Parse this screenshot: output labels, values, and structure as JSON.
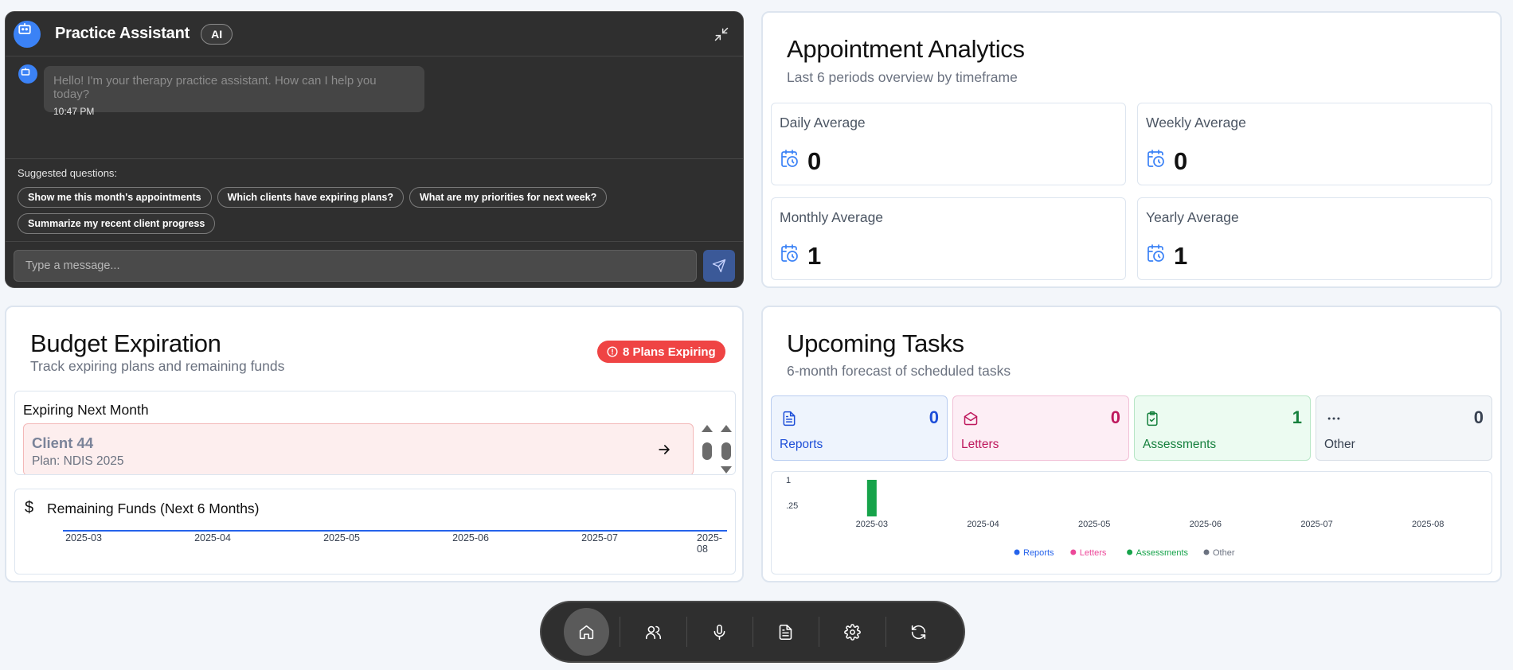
{
  "chat": {
    "title": "Practice Assistant",
    "badge": "AI",
    "message": {
      "text": "Hello! I'm your therapy practice assistant. How can I help you today?",
      "time": "10:47 PM"
    },
    "suggested_label": "Suggested questions:",
    "suggestions": [
      "Show me this month's appointments",
      "Which clients have expiring plans?",
      "What are my priorities for next week?",
      "Summarize my recent client progress"
    ],
    "input_placeholder": "Type a message..."
  },
  "analytics": {
    "title": "Appointment Analytics",
    "subtitle": "Last 6 periods overview by timeframe",
    "stats": [
      {
        "label": "Daily Average",
        "value": "0"
      },
      {
        "label": "Weekly Average",
        "value": "0"
      },
      {
        "label": "Monthly Average",
        "value": "1"
      },
      {
        "label": "Yearly Average",
        "value": "1"
      }
    ]
  },
  "budget": {
    "title": "Budget Expiration",
    "subtitle": "Track expiring plans and remaining funds",
    "badge": "8 Plans Expiring",
    "expiring_heading": "Expiring Next Month",
    "client": {
      "name": "Client 44",
      "plan": "Plan: NDIS 2025"
    },
    "funds_heading": "Remaining Funds (Next 6 Months)",
    "funds_months": [
      "2025-03",
      "2025-04",
      "2025-05",
      "2025-06",
      "2025-07",
      "2025-08"
    ]
  },
  "tasks": {
    "title": "Upcoming Tasks",
    "subtitle": "6-month forecast of scheduled tasks",
    "categories": [
      {
        "label": "Reports",
        "count": "0",
        "color": "#1d4ed8",
        "bg": "#eef4fd",
        "border": "#b9cdf0",
        "icon": "document-icon"
      },
      {
        "label": "Letters",
        "count": "0",
        "color": "#be185d",
        "bg": "#fdeef5",
        "border": "#f1bfd6",
        "icon": "envelope-open-icon"
      },
      {
        "label": "Assessments",
        "count": "1",
        "color": "#15803d",
        "bg": "#ecfbf1",
        "border": "#b7e6c6",
        "icon": "clipboard-check-icon"
      },
      {
        "label": "Other",
        "count": "0",
        "color": "#374151",
        "bg": "#f3f6f9",
        "border": "#d8dee6",
        "icon": "ellipsis-icon"
      }
    ]
  },
  "chart_data": {
    "type": "bar",
    "categories": [
      "2025-03",
      "2025-04",
      "2025-05",
      "2025-06",
      "2025-07",
      "2025-08"
    ],
    "series": [
      {
        "name": "Reports",
        "values": [
          0,
          0,
          0,
          0,
          0,
          0
        ],
        "color": "#2563eb"
      },
      {
        "name": "Letters",
        "values": [
          0,
          0,
          0,
          0,
          0,
          0
        ],
        "color": "#ec4899"
      },
      {
        "name": "Assessments",
        "values": [
          1,
          0,
          0,
          0,
          0,
          0
        ],
        "color": "#16a34a"
      },
      {
        "name": "Other",
        "values": [
          0,
          0,
          0,
          0,
          0,
          0
        ],
        "color": "#6b7280"
      }
    ],
    "y_tick_labels": [
      "1",
      ".25"
    ],
    "ylim": [
      0,
      1
    ],
    "legend": "bottom-center"
  },
  "nav": {
    "items": [
      {
        "name": "home-icon",
        "active": true
      },
      {
        "name": "users-icon",
        "active": false
      },
      {
        "name": "microphone-icon",
        "active": false
      },
      {
        "name": "file-text-icon",
        "active": false
      },
      {
        "name": "settings-icon",
        "active": false
      },
      {
        "name": "refresh-icon",
        "active": false
      }
    ]
  }
}
